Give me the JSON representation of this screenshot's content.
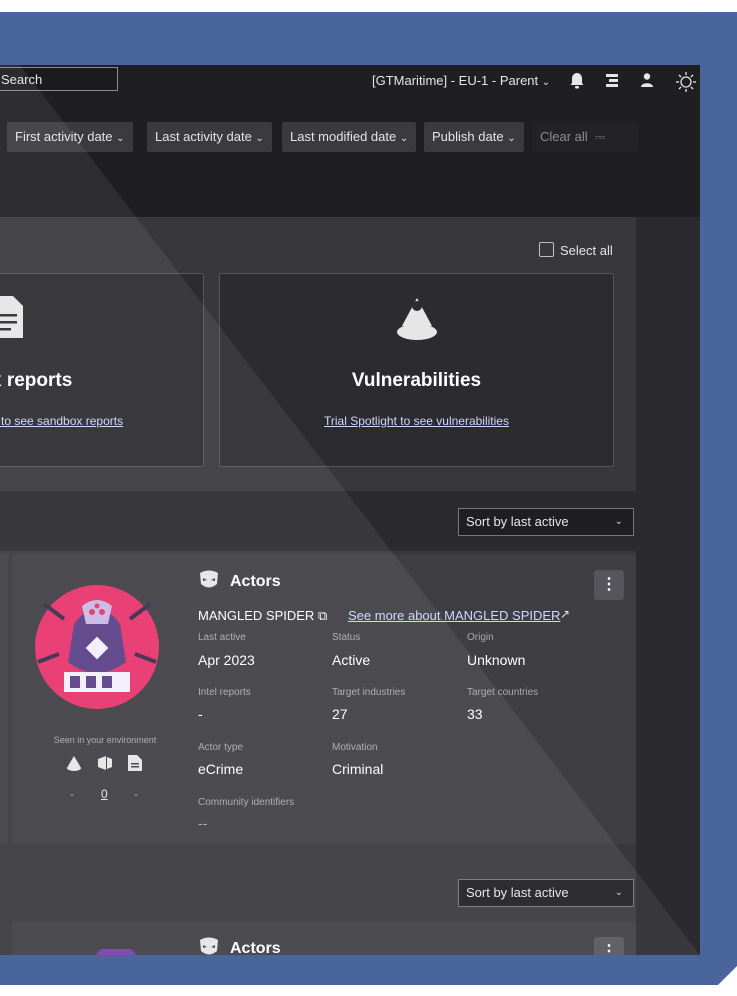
{
  "topbar": {
    "search_placeholder": "Search",
    "tenant_label": "[GTMaritime] - EU-1 - Parent",
    "icons": [
      "chevron-down-icon",
      "bell-icon",
      "app-switch-icon",
      "user-icon",
      "theme-sun-icon"
    ]
  },
  "filters": {
    "chips": [
      "First activity date",
      "Last activity date",
      "Last modified date",
      "Publish date"
    ],
    "clear_label": "Clear all"
  },
  "selection": {
    "select_all_label": "Select all"
  },
  "cards": [
    {
      "title": "x reports",
      "link": "e to see sandbox reports",
      "icon": "document-icon"
    },
    {
      "title": "Vulnerabilities",
      "link": "Trial Spotlight to see vulnerabilities",
      "icon": "vulnerability-icon"
    }
  ],
  "sort": {
    "label": "Sort by last active"
  },
  "actor_card": {
    "header": "Actors",
    "name": "MANGLED SPIDER",
    "see_more": "See more about MANGLED SPIDER",
    "fields": {
      "last_active_label": "Last active",
      "last_active": "Apr 2023",
      "status_label": "Status",
      "status": "Active",
      "origin_label": "Origin",
      "origin": "Unknown",
      "intel_reports_label": "Intel reports",
      "intel_reports": "-",
      "target_industries_label": "Target industries",
      "target_industries": "27",
      "target_countries_label": "Target countries",
      "target_countries": "33",
      "actor_type_label": "Actor type",
      "actor_type": "eCrime",
      "motivation_label": "Motivation",
      "motivation": "Criminal",
      "community_identifiers_label": "Community identifiers",
      "community_identifiers": "--"
    },
    "seen_in_env": "Seen in your environment",
    "seen_counts": [
      "-",
      "0",
      "-"
    ]
  },
  "second_section": {
    "sort_label": "Sort by last active",
    "header": "Actors"
  },
  "colors": {
    "frame": "#4a659b",
    "background": "#2b2b2f",
    "panel": "#38383c",
    "link": "#cdd8ff",
    "avatar_bg": "#e8336c"
  }
}
